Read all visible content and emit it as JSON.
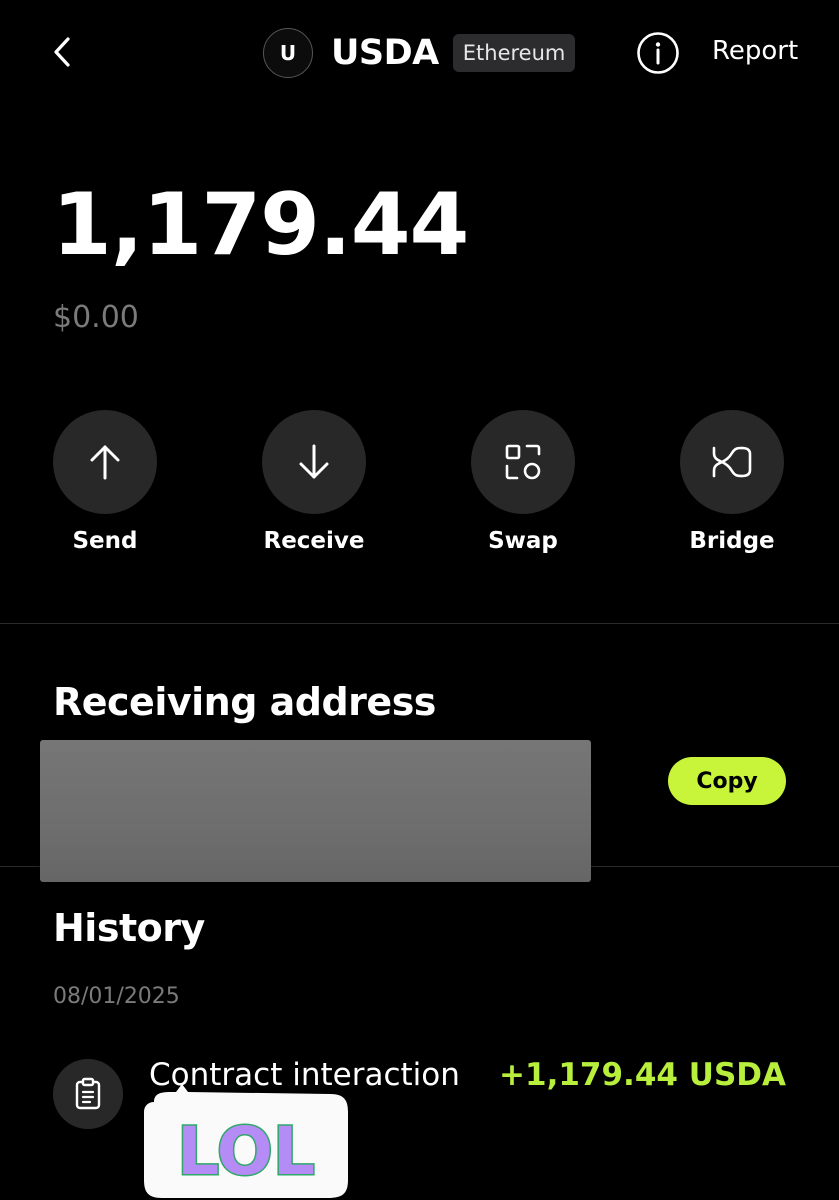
{
  "header": {
    "token_initial": "U",
    "token_symbol": "USDA",
    "network": "Ethereum",
    "report_label": "Report",
    "icons": [
      "chevron-left-icon",
      "info-icon"
    ]
  },
  "balance": {
    "amount": "1,179.44",
    "fiat_value": "$0.00"
  },
  "actions": [
    {
      "label": "Send",
      "icon": "arrow-up-icon"
    },
    {
      "label": "Receive",
      "icon": "arrow-down-icon"
    },
    {
      "label": "Swap",
      "icon": "swap-icon"
    },
    {
      "label": "Bridge",
      "icon": "bridge-icon"
    }
  ],
  "receiving": {
    "title": "Receiving address",
    "copy_label": "Copy"
  },
  "history": {
    "title": "History",
    "date": "08/01/2025",
    "transactions": [
      {
        "title": "Contract interaction",
        "amount": "+1,179.44 USDA",
        "icon": "clipboard-icon"
      }
    ]
  },
  "sticker": {
    "text": "LOL"
  },
  "colors": {
    "background": "#000000",
    "accent": "#c8f53a",
    "positive_amount": "#b7ef3c",
    "muted_text": "#7a7a7a",
    "button_bg": "#282828"
  }
}
